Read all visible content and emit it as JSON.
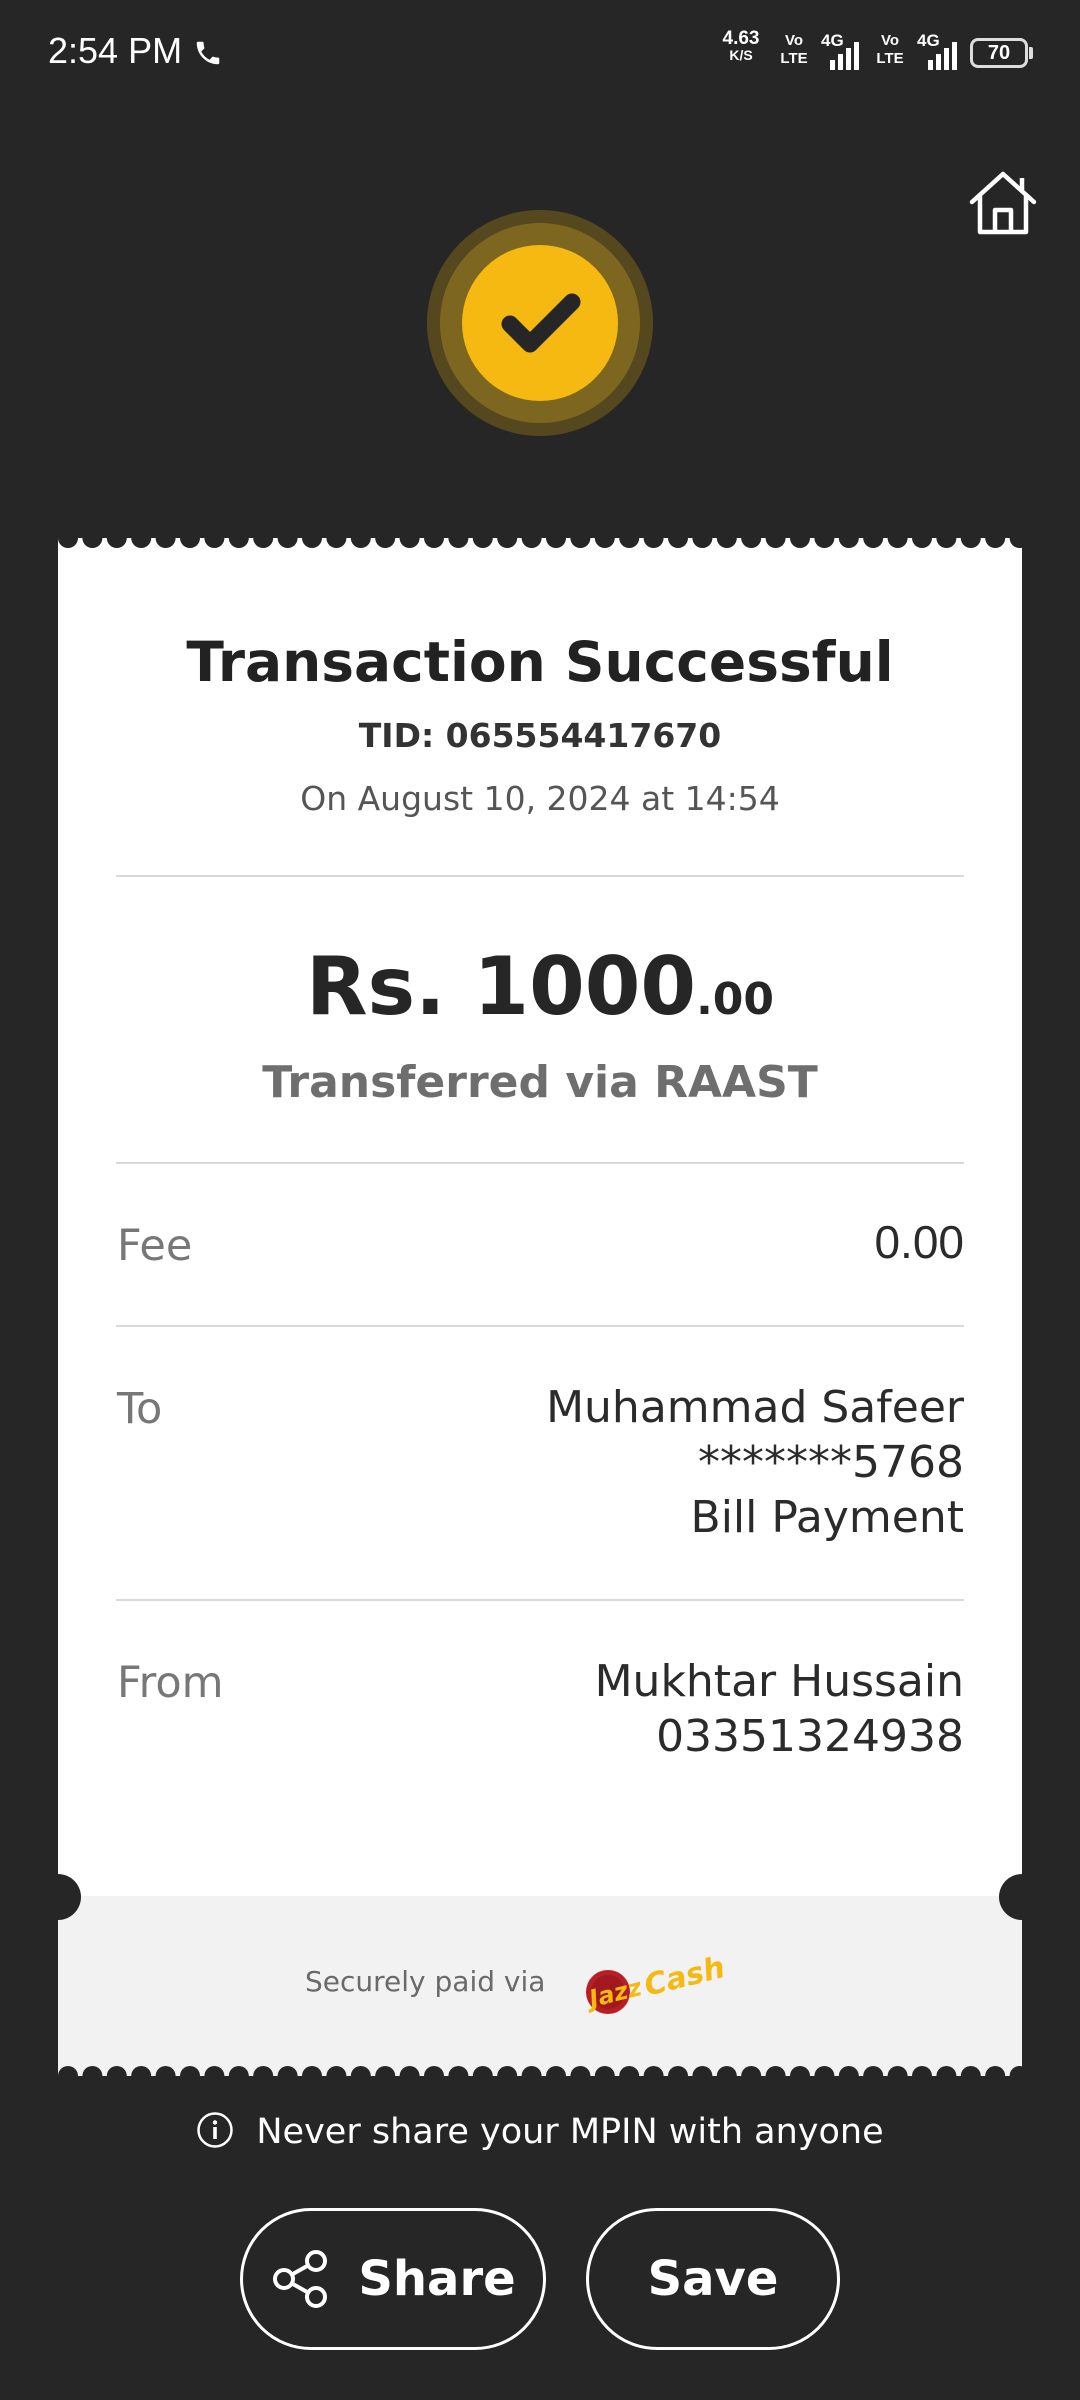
{
  "status_bar": {
    "time": "2:54 PM",
    "net_speed_value": "4.63",
    "net_speed_unit": "K/S",
    "sim1_type": "Vo LTE",
    "sim1_net": "4G",
    "sim2_type": "Vo LTE",
    "sim2_net": "4G",
    "battery": "70"
  },
  "header": {
    "home_icon": "home-icon",
    "status_icon": "check-icon",
    "accent_color": "#f5b912"
  },
  "receipt": {
    "title": "Transaction Successful",
    "tid": "TID: 065554417670",
    "date": "On August 10, 2024 at 14:54",
    "amount_main": "Rs. 1000",
    "amount_decimal": ".00",
    "transfer_method": "Transferred via RAAST",
    "fee": {
      "label": "Fee",
      "value": "0.00"
    },
    "to": {
      "label": "To",
      "name": "Muhammad Safeer",
      "account": "*******5768",
      "purpose": "Bill Payment"
    },
    "from": {
      "label": "From",
      "name": "Mukhtar Hussain",
      "account": "03351324938"
    },
    "secure_text": "Securely paid via",
    "logo_text": "JazzCash"
  },
  "footer": {
    "mpin_notice": "Never share your MPIN with anyone",
    "share_label": "Share",
    "save_label": "Save"
  }
}
